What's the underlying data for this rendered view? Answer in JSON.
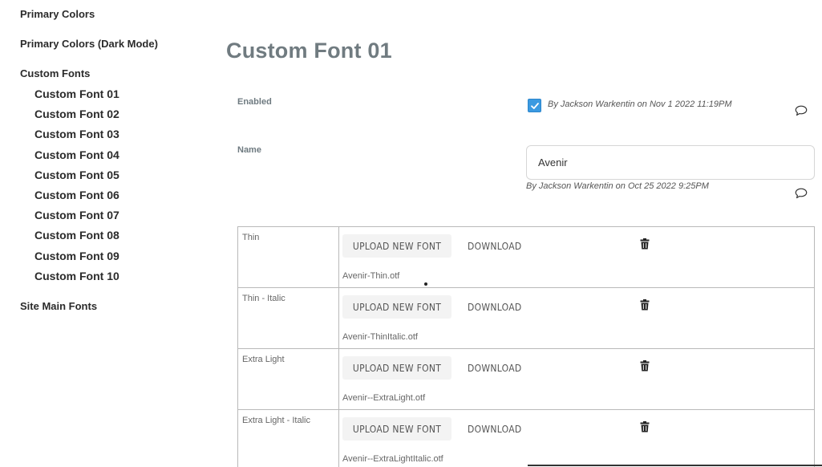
{
  "sidebar": {
    "groups": [
      {
        "label": "Primary Colors"
      },
      {
        "label": "Primary Colors (Dark Mode)"
      },
      {
        "label": "Custom Fonts"
      },
      {
        "label": "Site Main Fonts"
      }
    ],
    "custom_fonts": [
      "Custom Font 01",
      "Custom Font 02",
      "Custom Font 03",
      "Custom Font 04",
      "Custom Font 05",
      "Custom Font 06",
      "Custom Font 07",
      "Custom Font 08",
      "Custom Font 09",
      "Custom Font 10"
    ]
  },
  "main": {
    "title": "Custom Font 01",
    "enabled": {
      "label": "Enabled",
      "checked": true,
      "audit": "By Jackson Warkentin on Nov 1 2022 11:19PM"
    },
    "name": {
      "label": "Name",
      "value": "Avenir",
      "audit": "By Jackson Warkentin on Oct 25 2022 9:25PM"
    },
    "fonts": [
      {
        "label": "Thin",
        "upload_label": "UPLOAD NEW FONT",
        "download_label": "DOWNLOAD",
        "file": "Avenir-Thin.otf"
      },
      {
        "label": "Thin - Italic",
        "upload_label": "UPLOAD NEW FONT",
        "download_label": "DOWNLOAD",
        "file": "Avenir-ThinItalic.otf"
      },
      {
        "label": "Extra Light",
        "upload_label": "UPLOAD NEW FONT",
        "download_label": "DOWNLOAD",
        "file": "Avenir--ExtraLight.otf"
      },
      {
        "label": "Extra Light - Italic",
        "upload_label": "UPLOAD NEW FONT",
        "download_label": "DOWNLOAD",
        "file": "Avenir--ExtraLightItalic.otf"
      }
    ]
  },
  "colors": {
    "accent": "#3b9ae1",
    "title": "#707b80"
  },
  "icons": {
    "check": "check-icon",
    "comment": "comment-icon",
    "delete": "trash-icon"
  }
}
